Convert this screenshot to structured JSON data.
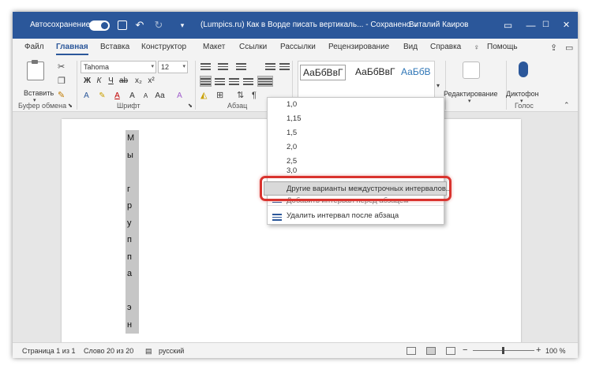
{
  "titlebar": {
    "autosave_label": "Автосохранение",
    "doc_title": "(Lumpics.ru) Как в Ворде писать вертикаль... - Сохранено",
    "title_arrow": "⌄",
    "user_name": "Виталий Каиров",
    "minimize": "—",
    "maximize": "☐",
    "close": "✕"
  },
  "tabs": [
    "Файл",
    "Главная",
    "Вставка",
    "Конструктор",
    "Макет",
    "Ссылки",
    "Рассылки",
    "Рецензирование",
    "Вид",
    "Справка",
    "Помощь"
  ],
  "ribbon": {
    "paste_label": "Вставить",
    "clipboard_group": "Буфер обмена",
    "font_group": "Шрифт",
    "paragraph_group": "Абзац",
    "voice_group": "Голос",
    "font_name": "Tahoma",
    "font_size": "12",
    "style_samples": [
      "АаБбВвГ",
      "АаБбВвГ",
      "АаБбВ"
    ],
    "edit_label": "Редактирование",
    "dictate_label": "Диктофон"
  },
  "document": {
    "letters": [
      "М",
      "ы",
      "",
      "г",
      "р",
      "у",
      "п",
      "п",
      "а",
      "",
      "э",
      "н"
    ]
  },
  "line_spacing_menu": {
    "values": [
      "1,0",
      "1,15",
      "1,5",
      "2,0",
      "2,5",
      "3,0"
    ],
    "more_options": "Другие варианты междустрочных интервалов...",
    "add_before": "Добавить интервал перед абзацем",
    "remove_after": "Удалить интервал после абзаца"
  },
  "statusbar": {
    "page": "Страница 1 из 1",
    "words": "Слово 20 из 20",
    "language": "русский",
    "zoom": "100 %"
  },
  "colors": {
    "word_blue": "#2b579a",
    "callout_red": "#d9332e"
  }
}
